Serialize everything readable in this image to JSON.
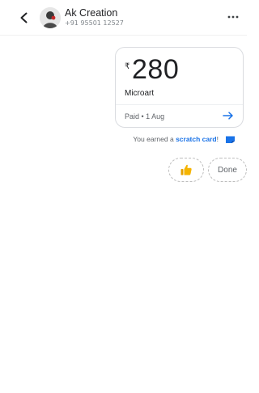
{
  "header": {
    "contact_name": "Ak Creation",
    "contact_phone": "+91 95501 12527",
    "icons": {
      "back": "back-arrow-icon",
      "avatar": "avatar",
      "more": "more-dots-icon"
    }
  },
  "payment_card": {
    "currency_symbol": "₹",
    "amount": "280",
    "payee": "Microart",
    "status": "Paid • 1 Aug",
    "arrow_icon": "arrow-right-icon"
  },
  "scratch": {
    "prefix": "You earned a",
    "link": "scratch card",
    "suffix": "!",
    "icon": "scratch-card-icon"
  },
  "quick_replies": {
    "thumb_icon": "thumbs-up-icon",
    "done_label": "Done"
  },
  "colors": {
    "accent": "#1a73e8",
    "thumb": "#f5b400",
    "text": "#202124",
    "muted": "#5f6368"
  }
}
